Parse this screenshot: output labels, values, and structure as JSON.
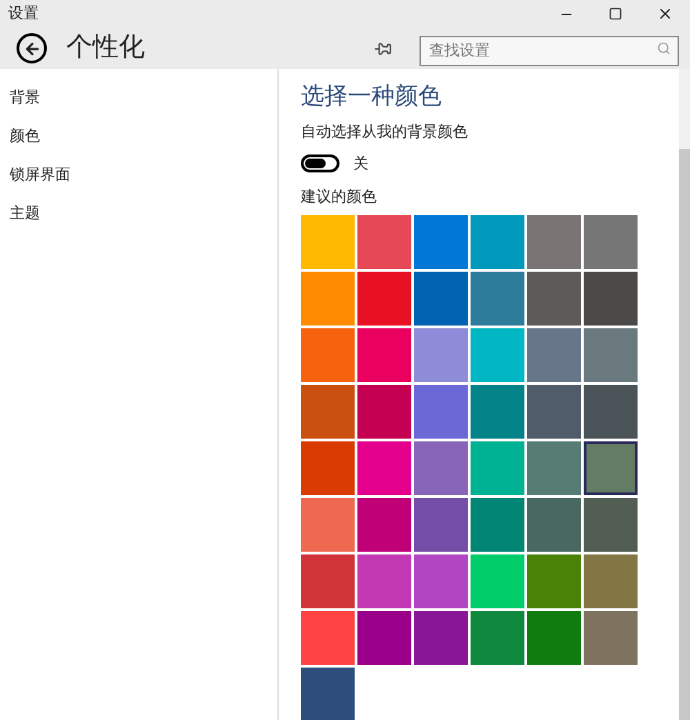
{
  "window": {
    "title": "设置"
  },
  "header": {
    "title": "个性化",
    "search": {
      "placeholder": "查找设置"
    }
  },
  "sidebar": {
    "items": [
      "背景",
      "颜色",
      "锁屏界面",
      "主题"
    ]
  },
  "content": {
    "heading": "选择一种颜色",
    "auto_label": "自动选择从我的背景颜色",
    "toggle": {
      "on": false,
      "label": "关"
    },
    "swatches_label": "建议的颜色",
    "swatches": [
      {
        "color": "#ffb900",
        "selected": false
      },
      {
        "color": "#e74856",
        "selected": false
      },
      {
        "color": "#0078d7",
        "selected": false
      },
      {
        "color": "#0099bc",
        "selected": false
      },
      {
        "color": "#7a7574",
        "selected": false
      },
      {
        "color": "#767676",
        "selected": false
      },
      {
        "color": "#ff8c00",
        "selected": false
      },
      {
        "color": "#e81123",
        "selected": false
      },
      {
        "color": "#0063b1",
        "selected": false
      },
      {
        "color": "#2d7d9a",
        "selected": false
      },
      {
        "color": "#5d5a58",
        "selected": false
      },
      {
        "color": "#4c4a48",
        "selected": false
      },
      {
        "color": "#f7630c",
        "selected": false
      },
      {
        "color": "#ea005e",
        "selected": false
      },
      {
        "color": "#8e8cd8",
        "selected": false
      },
      {
        "color": "#00b7c3",
        "selected": false
      },
      {
        "color": "#68768a",
        "selected": false
      },
      {
        "color": "#69797e",
        "selected": false
      },
      {
        "color": "#ca5010",
        "selected": false
      },
      {
        "color": "#c30052",
        "selected": false
      },
      {
        "color": "#6b69d6",
        "selected": false
      },
      {
        "color": "#038387",
        "selected": false
      },
      {
        "color": "#515c6b",
        "selected": false
      },
      {
        "color": "#4a5459",
        "selected": false
      },
      {
        "color": "#da3b01",
        "selected": false
      },
      {
        "color": "#e3008c",
        "selected": false
      },
      {
        "color": "#8764b8",
        "selected": false
      },
      {
        "color": "#00b294",
        "selected": false
      },
      {
        "color": "#567c73",
        "selected": false
      },
      {
        "color": "#647c64",
        "selected": true
      },
      {
        "color": "#ef6950",
        "selected": false
      },
      {
        "color": "#bf0077",
        "selected": false
      },
      {
        "color": "#744da9",
        "selected": false
      },
      {
        "color": "#018574",
        "selected": false
      },
      {
        "color": "#486860",
        "selected": false
      },
      {
        "color": "#525e54",
        "selected": false
      },
      {
        "color": "#d13438",
        "selected": false
      },
      {
        "color": "#c239b3",
        "selected": false
      },
      {
        "color": "#b146c2",
        "selected": false
      },
      {
        "color": "#00cc6a",
        "selected": false
      },
      {
        "color": "#498205",
        "selected": false
      },
      {
        "color": "#847545",
        "selected": false
      },
      {
        "color": "#ff4343",
        "selected": false
      },
      {
        "color": "#9a0089",
        "selected": false
      },
      {
        "color": "#881798",
        "selected": false
      },
      {
        "color": "#10893e",
        "selected": false
      },
      {
        "color": "#107c10",
        "selected": false
      },
      {
        "color": "#7e735f",
        "selected": false
      },
      {
        "color": "#2d4d7c",
        "selected": false
      }
    ]
  }
}
